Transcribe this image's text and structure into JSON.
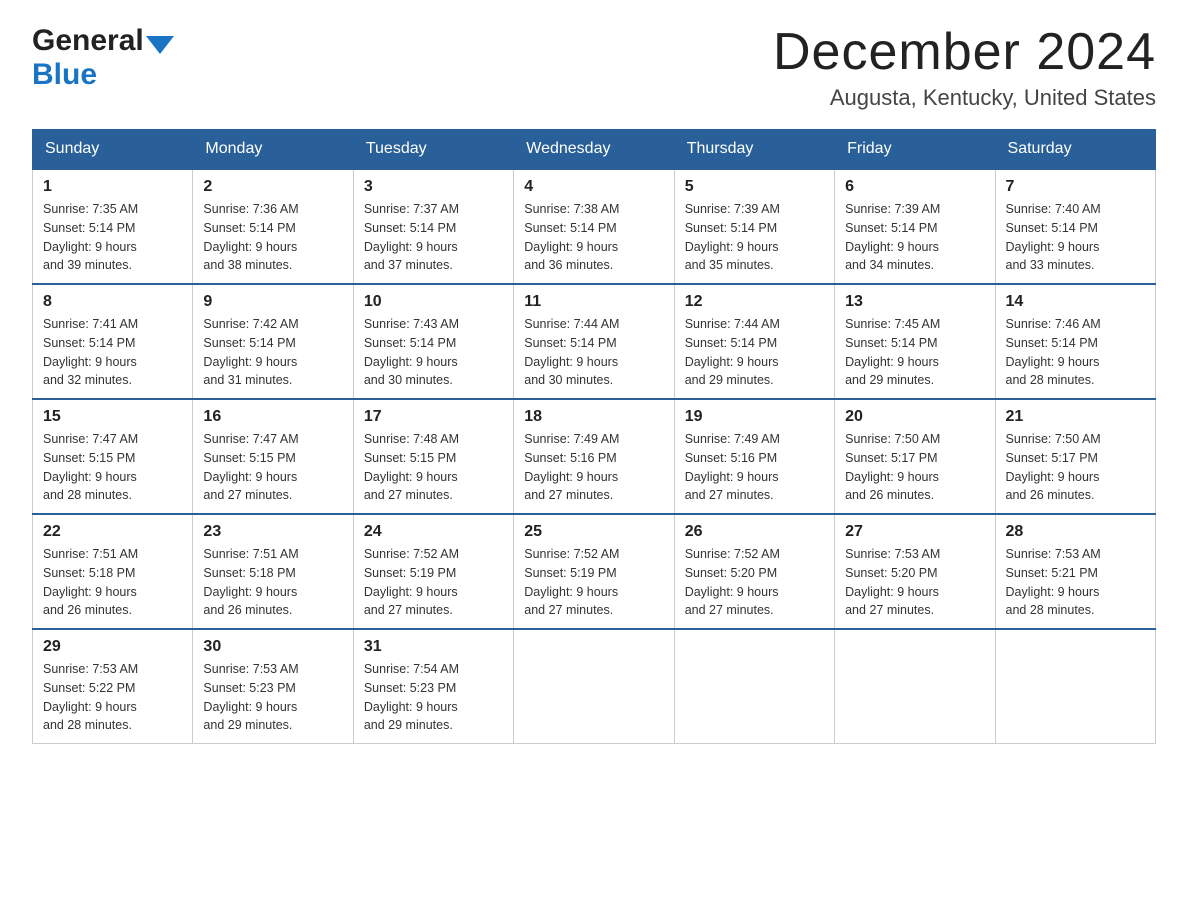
{
  "header": {
    "logo_general": "General",
    "logo_blue": "Blue",
    "month_title": "December 2024",
    "location": "Augusta, Kentucky, United States"
  },
  "days_of_week": [
    "Sunday",
    "Monday",
    "Tuesday",
    "Wednesday",
    "Thursday",
    "Friday",
    "Saturday"
  ],
  "weeks": [
    [
      {
        "day": "1",
        "sunrise": "7:35 AM",
        "sunset": "5:14 PM",
        "daylight": "9 hours and 39 minutes."
      },
      {
        "day": "2",
        "sunrise": "7:36 AM",
        "sunset": "5:14 PM",
        "daylight": "9 hours and 38 minutes."
      },
      {
        "day": "3",
        "sunrise": "7:37 AM",
        "sunset": "5:14 PM",
        "daylight": "9 hours and 37 minutes."
      },
      {
        "day": "4",
        "sunrise": "7:38 AM",
        "sunset": "5:14 PM",
        "daylight": "9 hours and 36 minutes."
      },
      {
        "day": "5",
        "sunrise": "7:39 AM",
        "sunset": "5:14 PM",
        "daylight": "9 hours and 35 minutes."
      },
      {
        "day": "6",
        "sunrise": "7:39 AM",
        "sunset": "5:14 PM",
        "daylight": "9 hours and 34 minutes."
      },
      {
        "day": "7",
        "sunrise": "7:40 AM",
        "sunset": "5:14 PM",
        "daylight": "9 hours and 33 minutes."
      }
    ],
    [
      {
        "day": "8",
        "sunrise": "7:41 AM",
        "sunset": "5:14 PM",
        "daylight": "9 hours and 32 minutes."
      },
      {
        "day": "9",
        "sunrise": "7:42 AM",
        "sunset": "5:14 PM",
        "daylight": "9 hours and 31 minutes."
      },
      {
        "day": "10",
        "sunrise": "7:43 AM",
        "sunset": "5:14 PM",
        "daylight": "9 hours and 30 minutes."
      },
      {
        "day": "11",
        "sunrise": "7:44 AM",
        "sunset": "5:14 PM",
        "daylight": "9 hours and 30 minutes."
      },
      {
        "day": "12",
        "sunrise": "7:44 AM",
        "sunset": "5:14 PM",
        "daylight": "9 hours and 29 minutes."
      },
      {
        "day": "13",
        "sunrise": "7:45 AM",
        "sunset": "5:14 PM",
        "daylight": "9 hours and 29 minutes."
      },
      {
        "day": "14",
        "sunrise": "7:46 AM",
        "sunset": "5:14 PM",
        "daylight": "9 hours and 28 minutes."
      }
    ],
    [
      {
        "day": "15",
        "sunrise": "7:47 AM",
        "sunset": "5:15 PM",
        "daylight": "9 hours and 28 minutes."
      },
      {
        "day": "16",
        "sunrise": "7:47 AM",
        "sunset": "5:15 PM",
        "daylight": "9 hours and 27 minutes."
      },
      {
        "day": "17",
        "sunrise": "7:48 AM",
        "sunset": "5:15 PM",
        "daylight": "9 hours and 27 minutes."
      },
      {
        "day": "18",
        "sunrise": "7:49 AM",
        "sunset": "5:16 PM",
        "daylight": "9 hours and 27 minutes."
      },
      {
        "day": "19",
        "sunrise": "7:49 AM",
        "sunset": "5:16 PM",
        "daylight": "9 hours and 27 minutes."
      },
      {
        "day": "20",
        "sunrise": "7:50 AM",
        "sunset": "5:17 PM",
        "daylight": "9 hours and 26 minutes."
      },
      {
        "day": "21",
        "sunrise": "7:50 AM",
        "sunset": "5:17 PM",
        "daylight": "9 hours and 26 minutes."
      }
    ],
    [
      {
        "day": "22",
        "sunrise": "7:51 AM",
        "sunset": "5:18 PM",
        "daylight": "9 hours and 26 minutes."
      },
      {
        "day": "23",
        "sunrise": "7:51 AM",
        "sunset": "5:18 PM",
        "daylight": "9 hours and 26 minutes."
      },
      {
        "day": "24",
        "sunrise": "7:52 AM",
        "sunset": "5:19 PM",
        "daylight": "9 hours and 27 minutes."
      },
      {
        "day": "25",
        "sunrise": "7:52 AM",
        "sunset": "5:19 PM",
        "daylight": "9 hours and 27 minutes."
      },
      {
        "day": "26",
        "sunrise": "7:52 AM",
        "sunset": "5:20 PM",
        "daylight": "9 hours and 27 minutes."
      },
      {
        "day": "27",
        "sunrise": "7:53 AM",
        "sunset": "5:20 PM",
        "daylight": "9 hours and 27 minutes."
      },
      {
        "day": "28",
        "sunrise": "7:53 AM",
        "sunset": "5:21 PM",
        "daylight": "9 hours and 28 minutes."
      }
    ],
    [
      {
        "day": "29",
        "sunrise": "7:53 AM",
        "sunset": "5:22 PM",
        "daylight": "9 hours and 28 minutes."
      },
      {
        "day": "30",
        "sunrise": "7:53 AM",
        "sunset": "5:23 PM",
        "daylight": "9 hours and 29 minutes."
      },
      {
        "day": "31",
        "sunrise": "7:54 AM",
        "sunset": "5:23 PM",
        "daylight": "9 hours and 29 minutes."
      },
      null,
      null,
      null,
      null
    ]
  ],
  "labels": {
    "sunrise": "Sunrise:",
    "sunset": "Sunset:",
    "daylight": "Daylight:"
  }
}
